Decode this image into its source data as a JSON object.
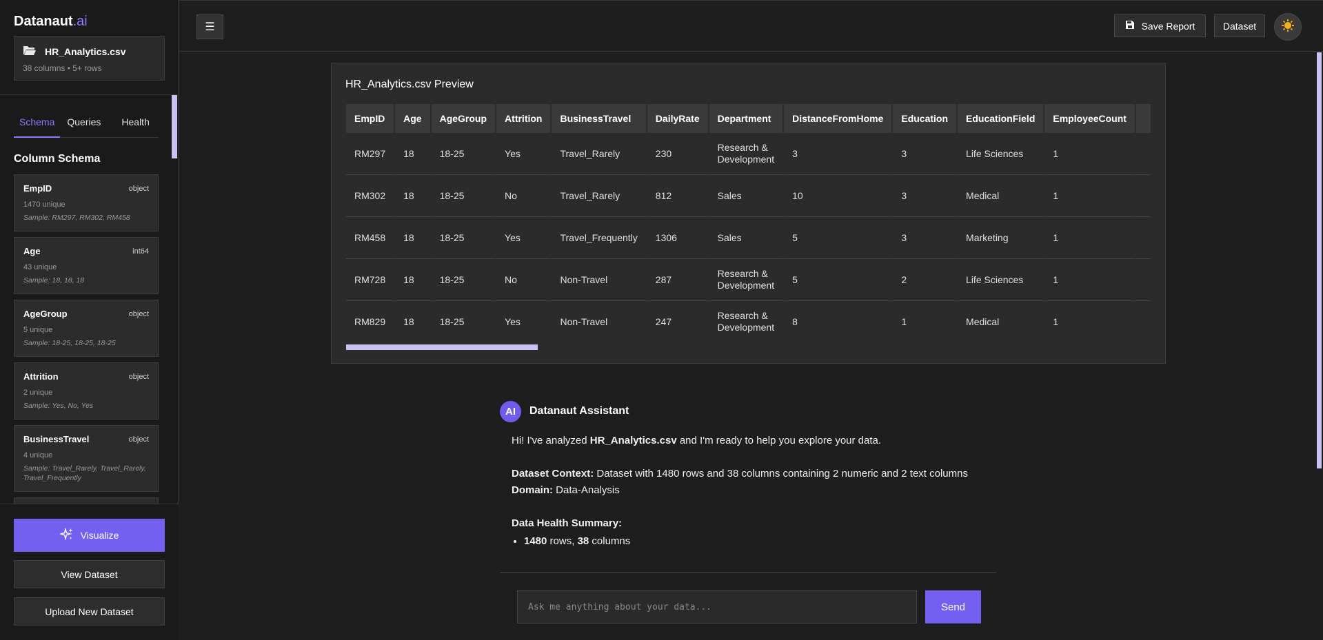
{
  "brand": {
    "name": "Datanaut",
    "suffix": ".ai"
  },
  "file": {
    "name": "HR_Analytics.csv",
    "meta": "38 columns • 5+ rows"
  },
  "tabs": [
    {
      "label": "Schema"
    },
    {
      "label": "Queries"
    },
    {
      "label": "Health"
    }
  ],
  "schema": {
    "title": "Column Schema",
    "columns": [
      {
        "name": "EmpID",
        "type": "object",
        "unique": "1470 unique",
        "sample": "Sample: RM297, RM302, RM458"
      },
      {
        "name": "Age",
        "type": "int64",
        "unique": "43 unique",
        "sample": "Sample: 18, 18, 18"
      },
      {
        "name": "AgeGroup",
        "type": "object",
        "unique": "5 unique",
        "sample": "Sample: 18-25, 18-25, 18-25"
      },
      {
        "name": "Attrition",
        "type": "object",
        "unique": "2 unique",
        "sample": "Sample: Yes, No, Yes"
      },
      {
        "name": "BusinessTravel",
        "type": "object",
        "unique": "4 unique",
        "sample": "Sample: Travel_Rarely, Travel_Rarely, Travel_Frequently"
      }
    ]
  },
  "sidebar_buttons": {
    "visualize": "Visualize",
    "view": "View Dataset",
    "upload": "Upload New Dataset"
  },
  "header": {
    "menu_icon": "☰",
    "save": "Save Report",
    "dataset": "Dataset"
  },
  "preview": {
    "title": "HR_Analytics.csv Preview",
    "headers": [
      "EmpID",
      "Age",
      "AgeGroup",
      "Attrition",
      "BusinessTravel",
      "DailyRate",
      "Department",
      "DistanceFromHome",
      "Education",
      "EducationField",
      "EmployeeCount"
    ],
    "rows": [
      [
        "RM297",
        "18",
        "18-25",
        "Yes",
        "Travel_Rarely",
        "230",
        "Research & Development",
        "3",
        "3",
        "Life Sciences",
        "1"
      ],
      [
        "RM302",
        "18",
        "18-25",
        "No",
        "Travel_Rarely",
        "812",
        "Sales",
        "10",
        "3",
        "Medical",
        "1"
      ],
      [
        "RM458",
        "18",
        "18-25",
        "Yes",
        "Travel_Frequently",
        "1306",
        "Sales",
        "5",
        "3",
        "Marketing",
        "1"
      ],
      [
        "RM728",
        "18",
        "18-25",
        "No",
        "Non-Travel",
        "287",
        "Research & Development",
        "5",
        "2",
        "Life Sciences",
        "1"
      ],
      [
        "RM829",
        "18",
        "18-25",
        "Yes",
        "Non-Travel",
        "247",
        "Research & Development",
        "8",
        "1",
        "Medical",
        "1"
      ]
    ]
  },
  "chat": {
    "avatar": "AI",
    "assistant": "Datanaut Assistant",
    "greeting_pre": "Hi! I've analyzed ",
    "greeting_file": "HR_Analytics.csv",
    "greeting_post": " and I'm ready to help you explore your data.",
    "context_label": "Dataset Context:",
    "context_text": " Dataset with 1480 rows and 38 columns containing 2 numeric and 2 text columns",
    "domain_label": "Domain:",
    "domain_text": " Data-Analysis",
    "health_title": "Data Health Summary:",
    "bullet_rows": "1480",
    "bullet_mid": " rows, ",
    "bullet_cols": "38",
    "bullet_end": " columns",
    "input_placeholder": "Ask me anything about your data...",
    "send": "Send"
  }
}
